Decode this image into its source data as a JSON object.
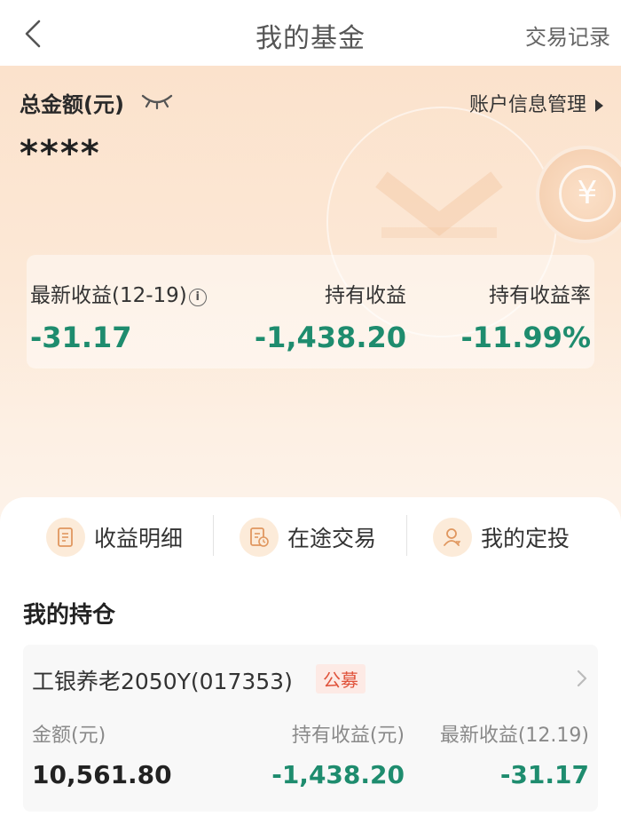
{
  "nav": {
    "title": "我的基金",
    "record_label": "交易记录"
  },
  "summary": {
    "total_label": "总金额(元)",
    "masked_amount": "****",
    "account_link": "账户信息管理"
  },
  "stats": [
    {
      "label": "最新收益(12-19)",
      "value": "-31.17"
    },
    {
      "label": "持有收益",
      "value": "-1,438.20"
    },
    {
      "label": "持有收益率",
      "value": "-11.99%"
    }
  ],
  "quick_actions": [
    {
      "label": "收益明细",
      "icon": "document-icon"
    },
    {
      "label": "在途交易",
      "icon": "pending-document-icon"
    },
    {
      "label": "我的定投",
      "icon": "user-icon"
    }
  ],
  "holdings": {
    "section_title": "我的持仓",
    "items": [
      {
        "name": "工银养老2050Y(017353)",
        "tag": "公募",
        "amount_label": "金额(元)",
        "amount": "10,561.80",
        "holding_return_label": "持有收益(元)",
        "holding_return": "-1,438.20",
        "latest_return_label": "最新收益(12.19)",
        "latest_return": "-31.17"
      }
    ]
  },
  "colors": {
    "negative": "#1e8c6e",
    "tag": "#e0533b",
    "hero_bg": "#fbe2cc"
  }
}
